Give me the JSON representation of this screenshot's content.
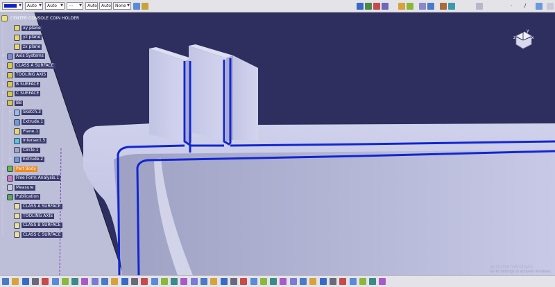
{
  "toolbar": {
    "color_swatch": "#1020c8",
    "combo_transparency": "Auto",
    "combo_line_weight": "Auto",
    "combo_line_type": "---",
    "combo_auto_a": "Auto",
    "combo_auto_b": "Auto",
    "combo_layer": "None"
  },
  "tree": {
    "root": "CENTER CONSOLE COIN HOLDER",
    "items": [
      {
        "label": "xy plane",
        "icon": "plane-icon"
      },
      {
        "label": "yz plane",
        "icon": "plane-icon"
      },
      {
        "label": "zx plane",
        "icon": "plane-icon"
      },
      {
        "label": "Axis Systems",
        "icon": "axis-icon"
      },
      {
        "label": "CLASS A SURFACE",
        "icon": "geometrical-set-icon"
      },
      {
        "label": "TOOLING AXIS",
        "icon": "geometrical-set-icon"
      },
      {
        "label": "B SURFACE",
        "icon": "geometrical-set-icon"
      },
      {
        "label": "C SURFACE",
        "icon": "geometrical-set-icon"
      },
      {
        "label": "BB",
        "icon": "geometrical-set-icon"
      },
      {
        "label": "Sketch.3",
        "icon": "sketch-icon"
      },
      {
        "label": "Extrude.1",
        "icon": "extrude-icon"
      },
      {
        "label": "Plane.1",
        "icon": "plane-icon"
      },
      {
        "label": "Intersect.5",
        "icon": "intersect-icon"
      },
      {
        "label": "Circle.1",
        "icon": "circle-icon"
      },
      {
        "label": "Extrude.2",
        "icon": "extrude-icon"
      },
      {
        "label": "Part Body",
        "icon": "part-body-icon"
      },
      {
        "label": "Free Form Analysis.1",
        "icon": "analysis-icon"
      },
      {
        "label": "Measure",
        "icon": "measure-icon"
      },
      {
        "label": "Publication",
        "icon": "publication-icon"
      },
      {
        "label": "CLASS A SURFACE",
        "icon": "publication-item-icon"
      },
      {
        "label": "TOOLING AXIS",
        "icon": "publication-item-icon"
      },
      {
        "label": "CLASS B SURFACE",
        "icon": "publication-item-icon"
      },
      {
        "label": "CLASS C SURFACE",
        "icon": "publication-item-icon"
      }
    ]
  },
  "compass": {
    "axis_x": "x",
    "axis_y": "y",
    "axis_z": "z"
  },
  "watermark": {
    "line1": "Activate Windows",
    "line2": "Go to Settings to activate Windows."
  },
  "colors": {
    "background": "#2e2f5e",
    "part": "#c4c6e6",
    "edge_highlight": "#1226d0",
    "active_node": "#f08a1c"
  }
}
